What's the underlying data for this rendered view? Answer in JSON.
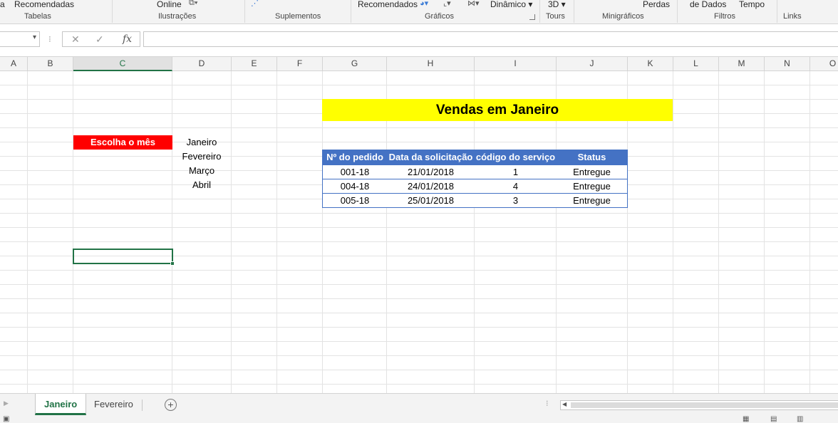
{
  "ribbon": {
    "top_labels": [
      "a",
      "Recomendadas",
      "Online",
      "Recomendados",
      "Dinâmico",
      "3D",
      "Perdas",
      "de Dados",
      "Tempo"
    ],
    "groups": [
      "Tabelas",
      "Ilustrações",
      "Suplementos",
      "Gráficos",
      "Tours",
      "Minigráficos",
      "Filtros",
      "Links"
    ]
  },
  "formula_bar": {
    "name_box": "",
    "cancel": "✕",
    "enter": "✓",
    "fx": "fx",
    "value": ""
  },
  "columns": [
    "A",
    "B",
    "C",
    "D",
    "E",
    "F",
    "G",
    "H",
    "I",
    "J",
    "K",
    "L",
    "M",
    "N",
    "O"
  ],
  "selected_column": "C",
  "sheet": {
    "title": "Vendas em Janeiro",
    "choose_label": "Escolha o mês",
    "months": [
      "Janeiro",
      "Fevereiro",
      "Março",
      "Abril"
    ],
    "table": {
      "headers": [
        "Nº do pedido",
        "Data da solicitação",
        "código do serviço",
        "Status"
      ],
      "rows": [
        [
          "001-18",
          "21/01/2018",
          "1",
          "Entregue"
        ],
        [
          "004-18",
          "24/01/2018",
          "4",
          "Entregue"
        ],
        [
          "005-18",
          "25/01/2018",
          "3",
          "Entregue"
        ]
      ]
    }
  },
  "tabs": [
    "Janeiro",
    "Fevereiro"
  ],
  "active_tab": "Janeiro",
  "colors": {
    "accent": "#217346",
    "table_header": "#4472c4",
    "title_fill": "#ffff00",
    "label_fill": "#ff0000"
  }
}
